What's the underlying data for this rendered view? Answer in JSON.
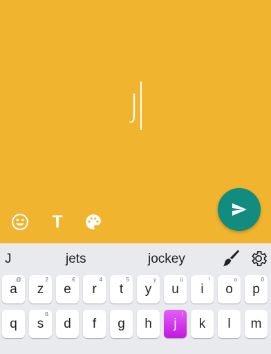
{
  "compose": {
    "typed_text": "J",
    "tools": [
      {
        "icon": "emoji-icon"
      },
      {
        "icon": "text-format-icon",
        "label": "T"
      },
      {
        "icon": "palette-icon"
      }
    ],
    "send_icon": "send-icon",
    "background_color": "#f0b42e",
    "send_color": "#128c7e"
  },
  "keyboard": {
    "suggestions": [
      "J",
      "jets",
      "jockey"
    ],
    "row1": [
      {
        "k": "a",
        "h": "@"
      },
      {
        "k": "z",
        "h": "2"
      },
      {
        "k": "e",
        "h": "€"
      },
      {
        "k": "r",
        "h": "4"
      },
      {
        "k": "t",
        "h": "5"
      },
      {
        "k": "y",
        "h": "y"
      },
      {
        "k": "u",
        "h": "ü"
      },
      {
        "k": "i",
        "h": "!"
      },
      {
        "k": "o",
        "h": "o"
      },
      {
        "k": "p",
        "h": "0"
      }
    ],
    "row2": [
      {
        "k": "q",
        "h": ""
      },
      {
        "k": "s",
        "h": "ß"
      },
      {
        "k": "d",
        "h": ""
      },
      {
        "k": "f",
        "h": ""
      },
      {
        "k": "g",
        "h": ""
      },
      {
        "k": "h",
        "h": ""
      },
      {
        "k": "j",
        "h": "!"
      },
      {
        "k": "k",
        "h": ""
      },
      {
        "k": "l",
        "h": ""
      },
      {
        "k": "m",
        "h": ""
      }
    ],
    "active_key": "j",
    "active_color": "#cf23ea"
  }
}
